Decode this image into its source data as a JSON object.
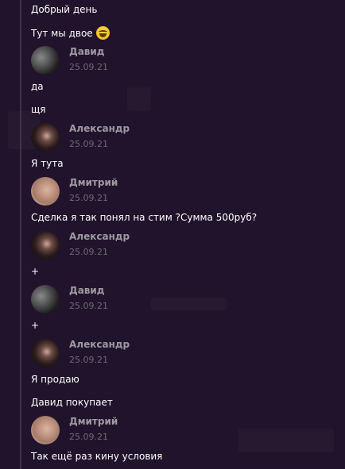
{
  "messages": [
    {
      "type": "text",
      "text": "Добрый день"
    },
    {
      "type": "text",
      "text": "Тут мы двое",
      "emoji": "laughing-emoji"
    },
    {
      "type": "header",
      "author": "Давид",
      "date": "25.09.21",
      "avatar": "david"
    },
    {
      "type": "text",
      "text": "да"
    },
    {
      "type": "text",
      "text": "щя"
    },
    {
      "type": "header",
      "author": "Александр",
      "date": "25.09.21",
      "avatar": "alex"
    },
    {
      "type": "text",
      "text": "Я тута"
    },
    {
      "type": "header",
      "author": "Дмитрий",
      "date": "25.09.21",
      "avatar": "dmitry"
    },
    {
      "type": "text",
      "text": "Сделка я так понял на стим ?Сумма 500руб?"
    },
    {
      "type": "header",
      "author": "Александр",
      "date": "25.09.21",
      "avatar": "alex"
    },
    {
      "type": "text",
      "text": "+"
    },
    {
      "type": "header",
      "author": "Давид",
      "date": "25.09.21",
      "avatar": "david"
    },
    {
      "type": "text",
      "text": "+"
    },
    {
      "type": "header",
      "author": "Александр",
      "date": "25.09.21",
      "avatar": "alex"
    },
    {
      "type": "text",
      "text": "Я продаю"
    },
    {
      "type": "text",
      "text": "Давид покупает"
    },
    {
      "type": "header",
      "author": "Дмитрий",
      "date": "25.09.21",
      "avatar": "dmitry"
    },
    {
      "type": "text",
      "text": "Так ещё раз кину условия"
    }
  ]
}
